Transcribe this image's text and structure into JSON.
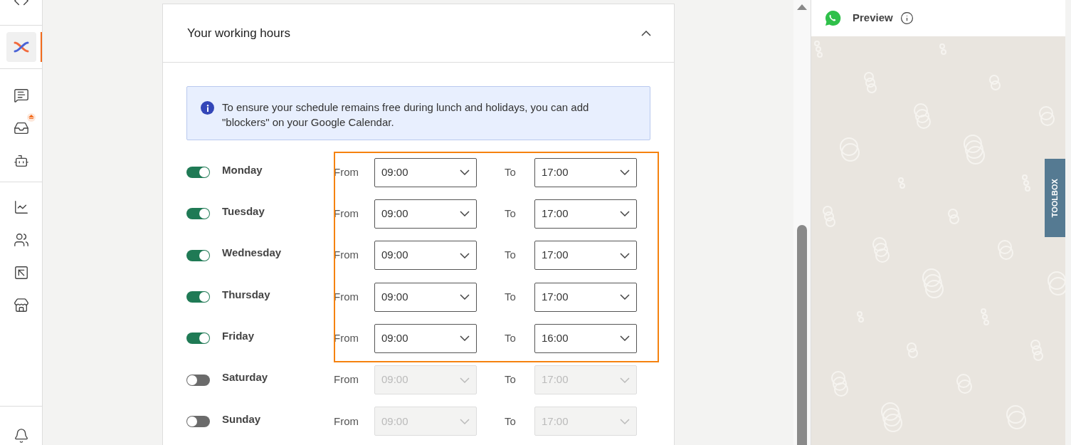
{
  "sidebar": {
    "items": [
      {
        "kind": "code",
        "selected": false
      },
      {
        "kind": "logo",
        "selected": true
      },
      {
        "kind": "chat",
        "selected": false
      },
      {
        "kind": "inbox",
        "selected": false,
        "badge": true
      },
      {
        "kind": "bot",
        "selected": false
      },
      {
        "kind": "chart",
        "selected": false
      },
      {
        "kind": "contacts",
        "selected": false
      },
      {
        "kind": "pointer",
        "selected": false
      },
      {
        "kind": "store",
        "selected": false
      },
      {
        "kind": "bell",
        "selected": false
      }
    ]
  },
  "card": {
    "title": "Your working hours",
    "expanded": true,
    "info": "To ensure your schedule remains free during lunch and holidays, you can add \"blockers\" on your Google Calendar.",
    "days": [
      {
        "name": "Monday",
        "on": true,
        "highlighted": true,
        "from_label": "From",
        "from": "09:00",
        "to_label": "To",
        "to": "17:00"
      },
      {
        "name": "Tuesday",
        "on": true,
        "highlighted": true,
        "from_label": "From",
        "from": "09:00",
        "to_label": "To",
        "to": "17:00"
      },
      {
        "name": "Wednesday",
        "on": true,
        "highlighted": true,
        "from_label": "From",
        "from": "09:00",
        "to_label": "To",
        "to": "17:00"
      },
      {
        "name": "Thursday",
        "on": true,
        "highlighted": true,
        "from_label": "From",
        "from": "09:00",
        "to_label": "To",
        "to": "17:00"
      },
      {
        "name": "Friday",
        "on": true,
        "highlighted": true,
        "from_label": "From",
        "from": "09:00",
        "to_label": "To",
        "to": "16:00"
      },
      {
        "name": "Saturday",
        "on": false,
        "highlighted": false,
        "from_label": "From",
        "from": "09:00",
        "to_label": "To",
        "to": "17:00"
      },
      {
        "name": "Sunday",
        "on": false,
        "highlighted": false,
        "from_label": "From",
        "from": "09:00",
        "to_label": "To",
        "to": "17:00"
      }
    ]
  },
  "preview": {
    "title": "Preview",
    "toolbox": "TOOLBOX"
  }
}
